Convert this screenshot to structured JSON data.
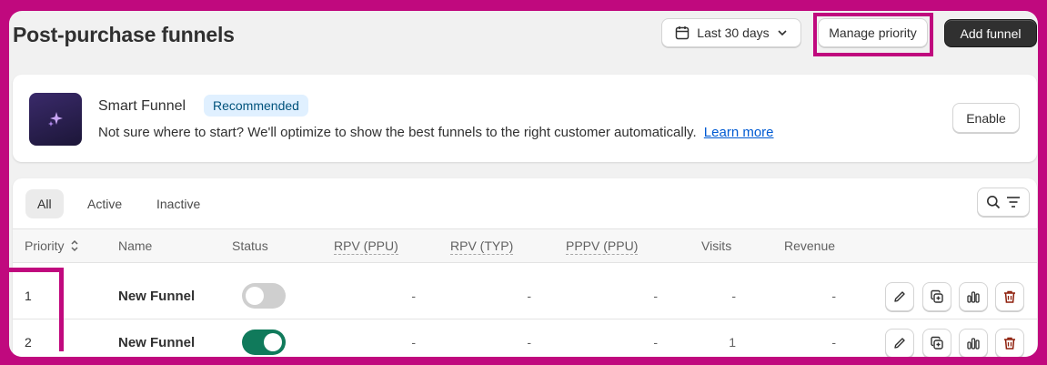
{
  "header": {
    "title": "Post-purchase funnels",
    "date_range": "Last 30 days",
    "manage_priority": "Manage priority",
    "add_funnel": "Add funnel"
  },
  "smart_funnel": {
    "title": "Smart Funnel",
    "badge": "Recommended",
    "description": "Not sure where to start? We'll optimize to show the best funnels to the right customer automatically.",
    "link": "Learn more",
    "enable": "Enable"
  },
  "tabs": [
    "All",
    "Active",
    "Inactive"
  ],
  "columns": {
    "priority": "Priority",
    "name": "Name",
    "status": "Status",
    "rpv_ppu": "RPV (PPU)",
    "rpv_typ": "RPV (TYP)",
    "pppv_ppu": "PPPV (PPU)",
    "visits": "Visits",
    "revenue": "Revenue"
  },
  "rows": [
    {
      "priority": "1",
      "name": "New Funnel",
      "status_on": false,
      "rpv_ppu": "-",
      "rpv_typ": "-",
      "pppv_ppu": "-",
      "visits": "-",
      "revenue": "-"
    },
    {
      "priority": "2",
      "name": "New Funnel",
      "status_on": true,
      "rpv_ppu": "-",
      "rpv_typ": "-",
      "pppv_ppu": "-",
      "visits": "1",
      "revenue": "-"
    }
  ],
  "colors": {
    "highlight": "#c0097e",
    "toggle_on": "#107a5b",
    "toggle_off": "#cfcfcf",
    "badge_bg": "#e0f0ff",
    "link": "#005bd3",
    "primary_button": "#303030",
    "delete_icon": "#8e1f0b"
  },
  "icons": {
    "date": "calendar-icon",
    "chevron": "chevron-down-icon",
    "smart": "sparkle-icon",
    "search": "search-icon",
    "filter": "filter-icon",
    "sort": "sort-icon",
    "actions": [
      "edit-icon",
      "duplicate-icon",
      "analytics-icon",
      "delete-icon"
    ]
  }
}
